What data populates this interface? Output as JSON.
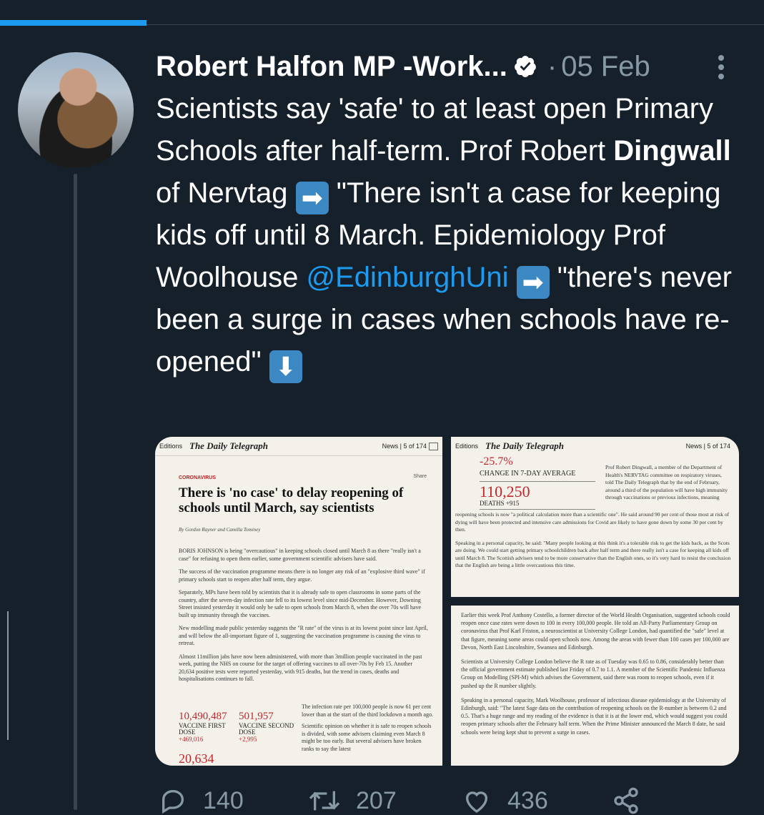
{
  "colors": {
    "background": "#15202b",
    "accent": "#1d9bf0",
    "secondary": "#8899a6"
  },
  "tweet": {
    "author_name": "Robert Halfon MP -Work...",
    "date": "05 Feb",
    "separator": "·",
    "text": {
      "t1": "Scientists say 'safe' to at least open Primary Schools after half-term. Prof Robert ",
      "t2": "Dingwall",
      "t3": " of Nervtag ",
      "t4": " \"There isn't a case for keeping kids off until 8 March. Epidemiology Prof Woolhouse ",
      "mention": "@EdinburghUni",
      "t5": " \"there's never been a surge in cases when schools have re-opened\" "
    },
    "icons": {
      "arrow_right": "➡",
      "arrow_down": "⬇",
      "verified": "verified-badge-icon",
      "more": "more-vertical-icon"
    }
  },
  "article1": {
    "editions": "Editions",
    "masthead": "The Daily Telegraph",
    "page": "News | 5 of 174",
    "kicker": "CORONAVIRUS",
    "share": "Share",
    "headline": "There is 'no case' to delay reopening of schools until March, say scientists",
    "byline": "By Gordon Rayner and Camilla Tominey",
    "para1": "BORIS JOHNSON is being \"overcautious\" in keeping schools closed until March 8 as there \"really isn't a case\" for refusing to open them earlier, some government scientific advisers have said.",
    "para2": "The success of the vaccination programme means there is no longer any risk of an \"explosive third wave\" if primary schools start to reopen after half term, they argue.",
    "para3": "Separately, MPs have been told by scientists that it is already safe to open classrooms in some parts of the country, after the seven-day infection rate fell to its lowest level since mid-December. However, Downing Street insisted yesterday it would only be safe to open schools from March 8, when the over 70s will have built up immunity through the vaccines.",
    "para4": "New modelling made public yesterday suggests the \"R rate\" of the virus is at its lowest point since last April, and will below the all-important figure of 1, suggesting the vaccination programme is causing the virus to retreat.",
    "para5": "Almost 11million jabs have now been administered, with more than 3million people vaccinated in the past week, putting the NHS on course for the target of offering vaccines to all over-70s by Feb 15. Another 20,634 positive tests were reported yesterday, with 915 deaths, but the trend in cases, deaths and hospitalisations continues to fall.",
    "stat1_num": "10,490,487",
    "stat1_lbl": "VACCINE FIRST DOSE",
    "stat1_chg": "+469,016",
    "stat2_num": "501,957",
    "stat2_lbl": "VACCINE SECOND DOSE",
    "stat2_chg": "+2,995",
    "stat3_num": "20,634",
    "side1": "The infection rate per 100,000 people is now 61 per cent lower than at the start of the third lockdown a month ago.",
    "side2": "Scientific opinion on whether it is safe to reopen schools is divided, with some advisers claiming even March 8 might be too early. But several advisers have broken ranks to say the latest"
  },
  "article2": {
    "editions": "Editions",
    "masthead": "The Daily Telegraph",
    "page": "News | 5 of 174",
    "pct": "-25.7%",
    "pct_lbl": "CHANGE IN 7-DAY AVERAGE",
    "num": "110,250",
    "num_lbl": "DEATHS +915",
    "col": "Prof Robert Dingwall, a member of the Department of Health's NERVTAG committee on respiratory viruses, told The Daily Telegraph that by the end of February, around a third of the population will have high immunity through vaccinations or previous infections, meaning",
    "para1": "reopening schools is now \"a political calculation more than a scientific one\". He said around 90 per cent of those most at risk of dying will have been protected and intensive care admissions for Covid are likely to have gone down by some 30 per cent by then.",
    "para2": "Speaking in a personal capacity, he said: \"Many people looking at this think it's a tolerable risk to get the kids back, as the Scots are doing. We could start getting primary schoolchildren back after half term and there really isn't a case for keeping all kids off until March 8. The Scottish advisers tend to be more conservative than the English ones, so it's very hard to resist the conclusion that the English are being a little overcautious this time."
  },
  "article3": {
    "para1": "Earlier this week Prof Anthony Costello, a former director of the World Health Organisation, suggested schools could reopen once case rates were down to 100 in every 100,000 people. He told an All-Party Parliamentary Group on coronavirus that Prof Karl Friston, a neuroscientist at University College London, had quantified the \"safe\" level at that figure, meaning some areas could open schools now. Among the areas with fewer than 100 cases per 100,000 are Devon, North East Lincolnshire, Swansea and Edinburgh.",
    "para2": "Scientists at University College London believe the R rate as of Tuesday was 0.65 to 0.86, considerably better than the official government estimate published last Friday of 0.7 to 1.1. A member of the Scientific Pandemic Influenza Group on Modelling (SPI-M) which advises the Government, said there was room to reopen schools, even if it pushed up the R number slightly.",
    "para3": "Speaking in a personal capacity, Mark Woolhouse, professor of infectious disease epidemiology at the University of Edinburgh, said: \"The latest Sage data on the contribution of reopening schools on the R-number is between 0.2 and 0.5. That's a huge range and my reading of the evidence is that it is at the lower end, which would suggest you could reopen primary schools after the February half term. When the Prime Minister announced the March 8 date, he said schools were being kept shut to prevent a surge in cases."
  },
  "actions": {
    "replies": "140",
    "retweets": "207",
    "likes": "436"
  }
}
